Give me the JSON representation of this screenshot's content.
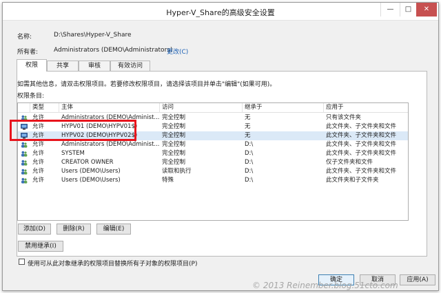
{
  "window": {
    "title": "Hyper-V_Share的高级安全设置",
    "controls": {
      "minimize": "—",
      "maximize": "□",
      "close": "✕"
    }
  },
  "info": {
    "name_label": "名称:",
    "name_value": "D:\\Shares\\Hyper-V_Share",
    "owner_label": "所有者:",
    "owner_value": "Administrators (DEMO\\Administrators)",
    "change_link": "更改(C)"
  },
  "tabs": [
    "权限",
    "共享",
    "审核",
    "有效访问"
  ],
  "instruction": "如需其他信息，请双击权限项目。若要修改权限项目，请选择该项目并单击\"编辑\"(如果可用)。",
  "entries_label": "权限条目:",
  "columns": [
    "类型",
    "主体",
    "访问",
    "继承于",
    "应用于"
  ],
  "rows": [
    {
      "icon": "users-icon",
      "type": "允许",
      "principal": "Administrators (DEMO\\Administ...",
      "access": "完全控制",
      "inherited": "无",
      "applies": "只有该文件夹",
      "selected": false
    },
    {
      "icon": "computer-icon",
      "type": "允许",
      "principal": "HYPV01 (DEMO\\HYPV01$)",
      "access": "完全控制",
      "inherited": "无",
      "applies": "此文件夹、子文件夹和文件",
      "selected": false
    },
    {
      "icon": "computer-icon",
      "type": "允许",
      "principal": "HYPV02 (DEMO\\HYPV02$)",
      "access": "完全控制",
      "inherited": "无",
      "applies": "此文件夹、子文件夹和文件",
      "selected": true
    },
    {
      "icon": "users-icon",
      "type": "允许",
      "principal": "Administrators (DEMO\\Administ...",
      "access": "完全控制",
      "inherited": "D:\\",
      "applies": "此文件夹、子文件夹和文件",
      "selected": false
    },
    {
      "icon": "users-icon",
      "type": "允许",
      "principal": "SYSTEM",
      "access": "完全控制",
      "inherited": "D:\\",
      "applies": "此文件夹、子文件夹和文件",
      "selected": false
    },
    {
      "icon": "users-icon",
      "type": "允许",
      "principal": "CREATOR OWNER",
      "access": "完全控制",
      "inherited": "D:\\",
      "applies": "仅子文件夹和文件",
      "selected": false
    },
    {
      "icon": "users-icon",
      "type": "允许",
      "principal": "Users (DEMO\\Users)",
      "access": "读取和执行",
      "inherited": "D:\\",
      "applies": "此文件夹、子文件夹和文件",
      "selected": false
    },
    {
      "icon": "users-icon",
      "type": "允许",
      "principal": "Users (DEMO\\Users)",
      "access": "特殊",
      "inherited": "D:\\",
      "applies": "此文件夹和子文件夹",
      "selected": false
    }
  ],
  "buttons": {
    "add": "添加(D)",
    "remove": "删除(R)",
    "edit": "编辑(E)",
    "disable_inheritance": "禁用继承(I)"
  },
  "replace_checkbox_label": "使用可从此对象继承的权限项目替换所有子对象的权限项目(P)",
  "footer": {
    "ok": "确定",
    "cancel": "取消",
    "apply": "应用(A)"
  },
  "watermark": "© 2013 Reinember.blog.51cto.com",
  "colors": {
    "selection": "#dbe9f7",
    "highlight_box": "#e8141c",
    "close_button": "#c75050",
    "link": "#1a5fb4"
  }
}
